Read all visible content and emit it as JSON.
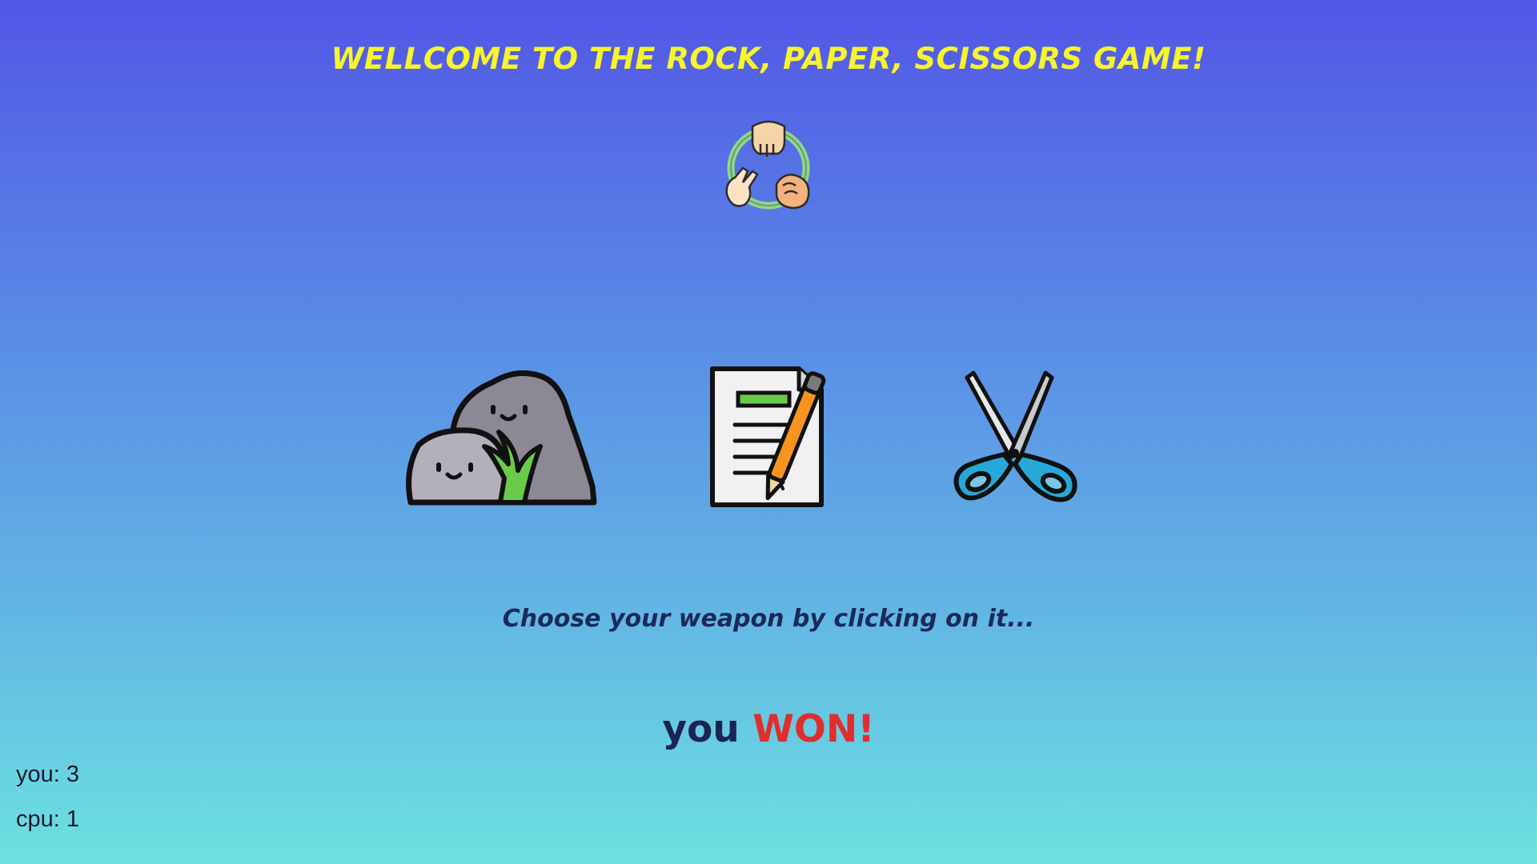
{
  "header": {
    "title": "WELLCOME TO THE ROCK, PAPER, SCISSORS GAME!"
  },
  "logo": {
    "icon": "rock-paper-scissors-hands-icon"
  },
  "weapons": [
    {
      "id": "rock",
      "icon": "rock-icon"
    },
    {
      "id": "paper",
      "icon": "paper-icon"
    },
    {
      "id": "scissors",
      "icon": "scissors-icon"
    }
  ],
  "instruction": "Choose your weapon by clicking on it...",
  "result": {
    "prefix": "you",
    "outcome": "WON!",
    "outcome_color": "#e12d2d"
  },
  "score": {
    "you_label": "you: 3",
    "cpu_label": "cpu: 1",
    "you": 3,
    "cpu": 1
  },
  "colors": {
    "title": "#f5f52a",
    "text_dark": "#1c2552",
    "bg_top": "#5256e6",
    "bg_bottom": "#6ce1e0"
  }
}
